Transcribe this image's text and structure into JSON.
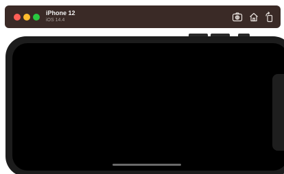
{
  "window": {
    "device_name": "iPhone 12",
    "os_version": "iOS 14.4",
    "traffic_lights": {
      "close": "#ff5f57",
      "minimize": "#febc2e",
      "zoom": "#28c840"
    },
    "toolbar_icons": [
      "screenshot-icon",
      "home-icon",
      "rotate-icon"
    ]
  },
  "device": {
    "frame_color": "#1c1c1c",
    "screen_color": "#000000",
    "orientation": "landscape"
  }
}
